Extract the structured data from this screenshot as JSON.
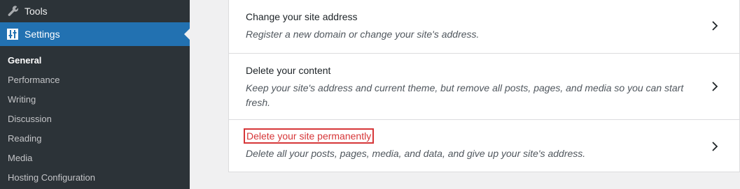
{
  "sidebar": {
    "tools_label": "Tools",
    "settings_label": "Settings",
    "submenu": [
      {
        "label": "General",
        "current": true
      },
      {
        "label": "Performance"
      },
      {
        "label": "Writing"
      },
      {
        "label": "Discussion"
      },
      {
        "label": "Reading"
      },
      {
        "label": "Media"
      },
      {
        "label": "Hosting Configuration"
      }
    ],
    "colors": {
      "background": "#2c3338",
      "active": "#2271b1"
    },
    "icons": {
      "tools": "wrench-icon",
      "settings": "settings-sliders-icon"
    }
  },
  "options": [
    {
      "title": "Change your site address",
      "description": "Register a new domain or change your site's address."
    },
    {
      "title": "Delete your content",
      "description": "Keep your site's address and current theme, but remove all posts, pages, and media so you can start fresh."
    },
    {
      "title": "Delete your site permanently",
      "description": "Delete all your posts, pages, media, and data, and give up your site's address.",
      "highlight_color": "#d63638"
    }
  ]
}
